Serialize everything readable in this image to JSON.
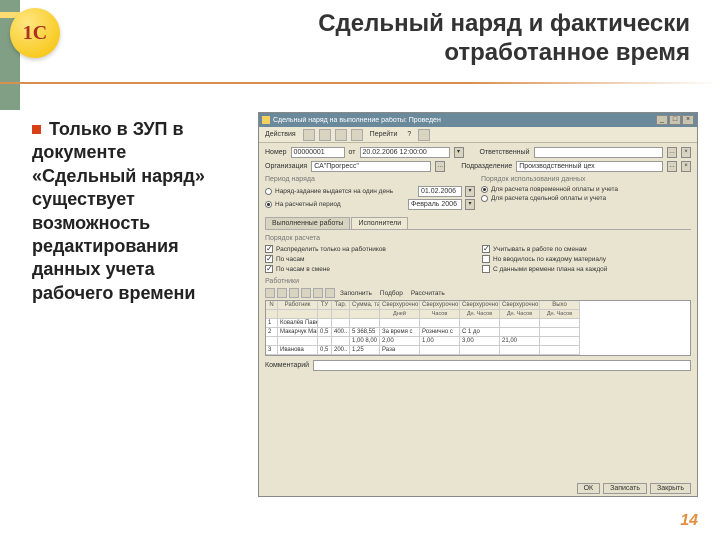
{
  "slide": {
    "title": "Сдельный наряд и фактически отработанное время",
    "bullet": "Только в ЗУП в документе «Сдельный наряд» существует возможность редактирования данных учета рабочего времени",
    "page_number": "14"
  },
  "window": {
    "title": "Сдельный наряд на выполнение работы: Проведен",
    "toolbar": {
      "actions": "Действия",
      "go": "Перейти",
      "help": "?"
    },
    "fields": {
      "number_lbl": "Номер",
      "number_val": "00000001",
      "date_lbl": "от",
      "date_val": "20.02.2006 12:00:00",
      "org_lbl": "Организация",
      "org_val": "СА\"Прогресс\"",
      "resp_lbl": "Ответственный",
      "resp_val": "",
      "dept_lbl": "Подразделение",
      "dept_val": "Производственный цех"
    },
    "period": {
      "title": "Период наряда",
      "r1": "Наряд-задание выдается на один день",
      "r1_date": "01.02.2006",
      "r2": "На расчетный период",
      "r2_val": "Февраль 2006"
    },
    "usage": {
      "title": "Порядок использования данных",
      "r1": "Для расчета повременной оплаты и учета",
      "r2": "Для расчета сдельной оплаты и учета"
    },
    "tabs": {
      "t1": "Выполненные работы",
      "t2": "Исполнители"
    },
    "calc_title": "Порядок расчета",
    "checks": {
      "c1": "Распределить только на работников",
      "c2": "Учитывать в работе по сменам",
      "c3": "По часам",
      "c4": "Но вводилось по каждому материалу",
      "c5": "По часам в смене",
      "c6": "С данными времени плана на каждой"
    },
    "emp_title": "Работники",
    "emp_toolbar": {
      "fill": "Заполнить",
      "select": "Подбор",
      "calc": "Рассчитать"
    },
    "table": {
      "h_n": "N",
      "h_worker": "Работник",
      "h_tu": "ТУ",
      "h_tar": "Тар.",
      "h_sum": "Сумма, тариф план",
      "h_sv1": "Сверхурочно",
      "h_sv2": "Сверхурочно",
      "h_sv3": "Сверхурочно",
      "h_sv4": "Сверхурочно",
      "h_out": "Выхо",
      "h_sub_dn": "Дней",
      "h_sub_ch": "Часов",
      "h_sub_dch": "Дн. Часов",
      "rows": [
        {
          "n": "1",
          "w": "Ковалёв Павел Ив.",
          "tu": "",
          "tar": "",
          "sum": "",
          "a": "",
          "b": "",
          "c": "",
          "d": "",
          "e": ""
        },
        {
          "n": "2",
          "w": "Макарчук Макс",
          "tu": "0,5",
          "tar": "400..",
          "sum": "5 368,55",
          "a": "За время с",
          "b": "Рознично с",
          "c": "С 1 до",
          "d": "",
          "e": ""
        },
        {
          "n": "",
          "w": "",
          "tu": "",
          "tar": "",
          "sum": "1,00  8,00",
          "a": "2,00",
          "b": "1,00",
          "c": "3,00",
          "d": "21,00",
          "e": ""
        },
        {
          "n": "3",
          "w": "Иванова",
          "tu": "0,5",
          "tar": "200..",
          "sum": "1,25",
          "a": "Раза",
          "b": "",
          "c": "",
          "d": "",
          "e": ""
        }
      ]
    },
    "comment_lbl": "Комментарий",
    "buttons": {
      "ok": "ОК",
      "save": "Записать",
      "close": "Закрыть"
    }
  }
}
